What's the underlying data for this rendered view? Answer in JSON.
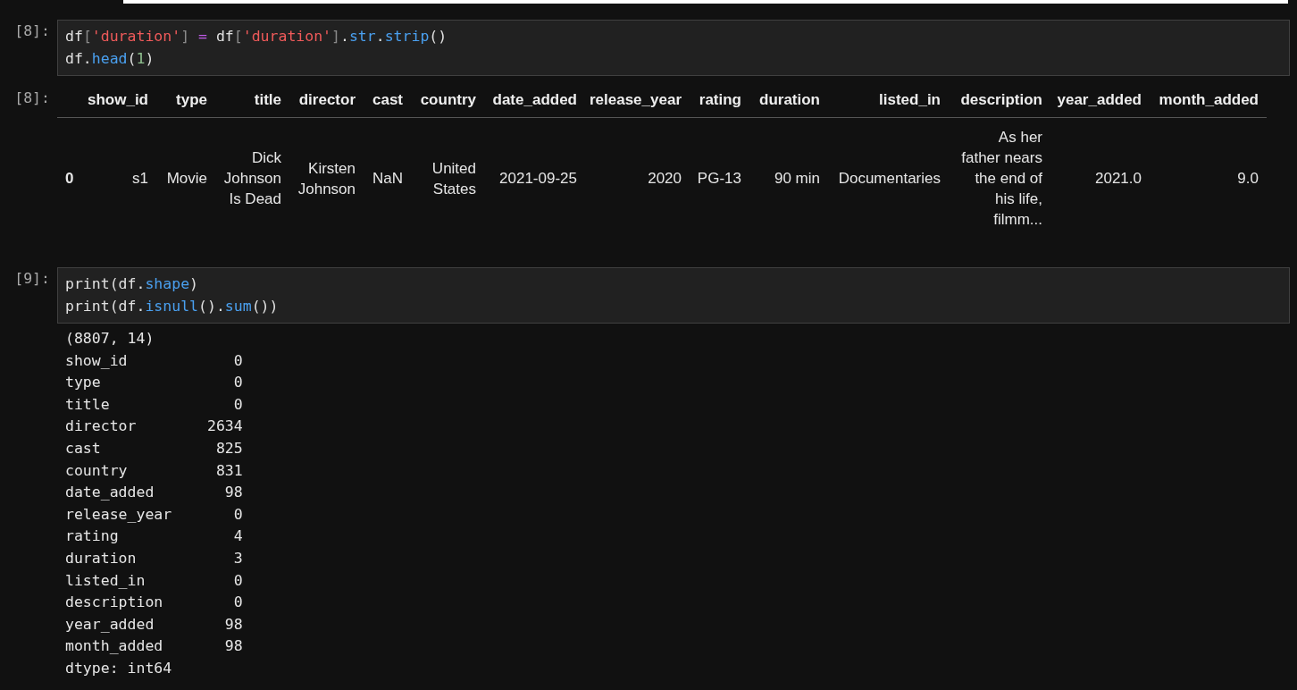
{
  "cells": [
    {
      "kind": "table",
      "prompt": "[8]:",
      "out_prompt": "[8]:",
      "code": [
        [
          {
            "kind": "plain",
            "text": "df"
          },
          {
            "kind": "punct",
            "text": "["
          },
          {
            "kind": "string",
            "text": "'duration'"
          },
          {
            "kind": "punct",
            "text": "]"
          },
          {
            "kind": "op",
            "text": " = "
          },
          {
            "kind": "plain",
            "text": "df"
          },
          {
            "kind": "punct",
            "text": "["
          },
          {
            "kind": "string",
            "text": "'duration'"
          },
          {
            "kind": "punct",
            "text": "]"
          },
          {
            "kind": "plain",
            "text": "."
          },
          {
            "kind": "attr",
            "text": "str"
          },
          {
            "kind": "plain",
            "text": "."
          },
          {
            "kind": "attr",
            "text": "strip"
          },
          {
            "kind": "plain",
            "text": "()"
          }
        ],
        [
          {
            "kind": "plain",
            "text": "df."
          },
          {
            "kind": "attr",
            "text": "head"
          },
          {
            "kind": "plain",
            "text": "("
          },
          {
            "kind": "number",
            "text": "1"
          },
          {
            "kind": "plain",
            "text": ")"
          }
        ]
      ],
      "table": {
        "columns": [
          null,
          "show_id",
          "type",
          "title",
          "director",
          "cast",
          "country",
          "date_added",
          "release_year",
          "rating",
          "duration",
          "listed_in",
          "description",
          "year_added",
          "month_added"
        ],
        "rows": [
          [
            "0",
            "s1",
            "Movie",
            "Dick Johnson Is Dead",
            "Kirsten Johnson",
            "NaN",
            "United States",
            "2021-09-25",
            "2020",
            "PG-13",
            "90 min",
            "Documentaries",
            "As her father nears the end of his life, filmm...",
            "2021.0",
            "9.0"
          ]
        ]
      }
    },
    {
      "kind": "stream",
      "prompt": "[9]:",
      "code": [
        [
          {
            "kind": "plain",
            "text": "print(df."
          },
          {
            "kind": "attr",
            "text": "shape"
          },
          {
            "kind": "plain",
            "text": ")"
          }
        ],
        [
          {
            "kind": "plain",
            "text": "print(df."
          },
          {
            "kind": "attr",
            "text": "isnull"
          },
          {
            "kind": "plain",
            "text": "()."
          },
          {
            "kind": "attr",
            "text": "sum"
          },
          {
            "kind": "plain",
            "text": "())"
          }
        ]
      ],
      "output": [
        "(8807, 14)",
        "show_id            0",
        "type               0",
        "title              0",
        "director        2634",
        "cast             825",
        "country          831",
        "date_added        98",
        "release_year       0",
        "rating             4",
        "duration           3",
        "listed_in          0",
        "description        0",
        "year_added        98",
        "month_added       98",
        "dtype: int64"
      ]
    }
  ]
}
